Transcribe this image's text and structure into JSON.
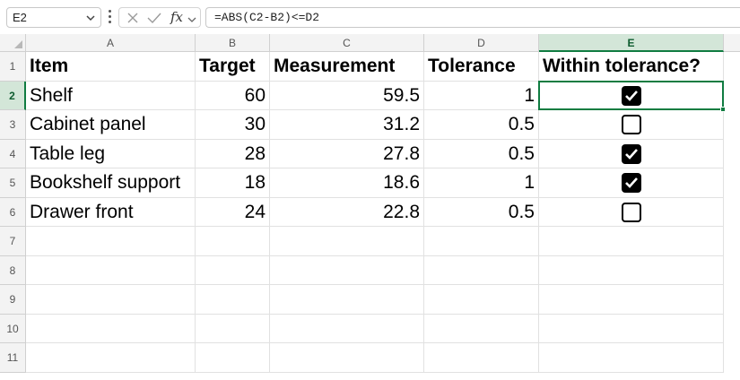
{
  "name_box": {
    "value": "E2"
  },
  "formula_bar": {
    "formula": "=ABS(C2-B2)<=D2",
    "fx_label": "fx"
  },
  "columns": [
    "A",
    "B",
    "C",
    "D",
    "E"
  ],
  "row_numbers": [
    "1",
    "2",
    "3",
    "4",
    "5",
    "6",
    "7",
    "8",
    "9",
    "10",
    "11"
  ],
  "selected_cell": "E2",
  "header_row": [
    "Item",
    "Target",
    "Measurement",
    "Tolerance",
    "Within tolerance?"
  ],
  "rows": [
    {
      "item": "Shelf",
      "target": "60",
      "measurement": "59.5",
      "tolerance": "1",
      "within": true
    },
    {
      "item": "Cabinet panel",
      "target": "30",
      "measurement": "31.2",
      "tolerance": "0.5",
      "within": false
    },
    {
      "item": "Table leg",
      "target": "28",
      "measurement": "27.8",
      "tolerance": "0.5",
      "within": true
    },
    {
      "item": "Bookshelf support",
      "target": "18",
      "measurement": "18.6",
      "tolerance": "1",
      "within": true
    },
    {
      "item": "Drawer front",
      "target": "24",
      "measurement": "22.8",
      "tolerance": "0.5",
      "within": false
    }
  ],
  "colors": {
    "selection": "#107c41",
    "header_bg": "#f3f3f3",
    "gridline": "#e1e1e1"
  }
}
